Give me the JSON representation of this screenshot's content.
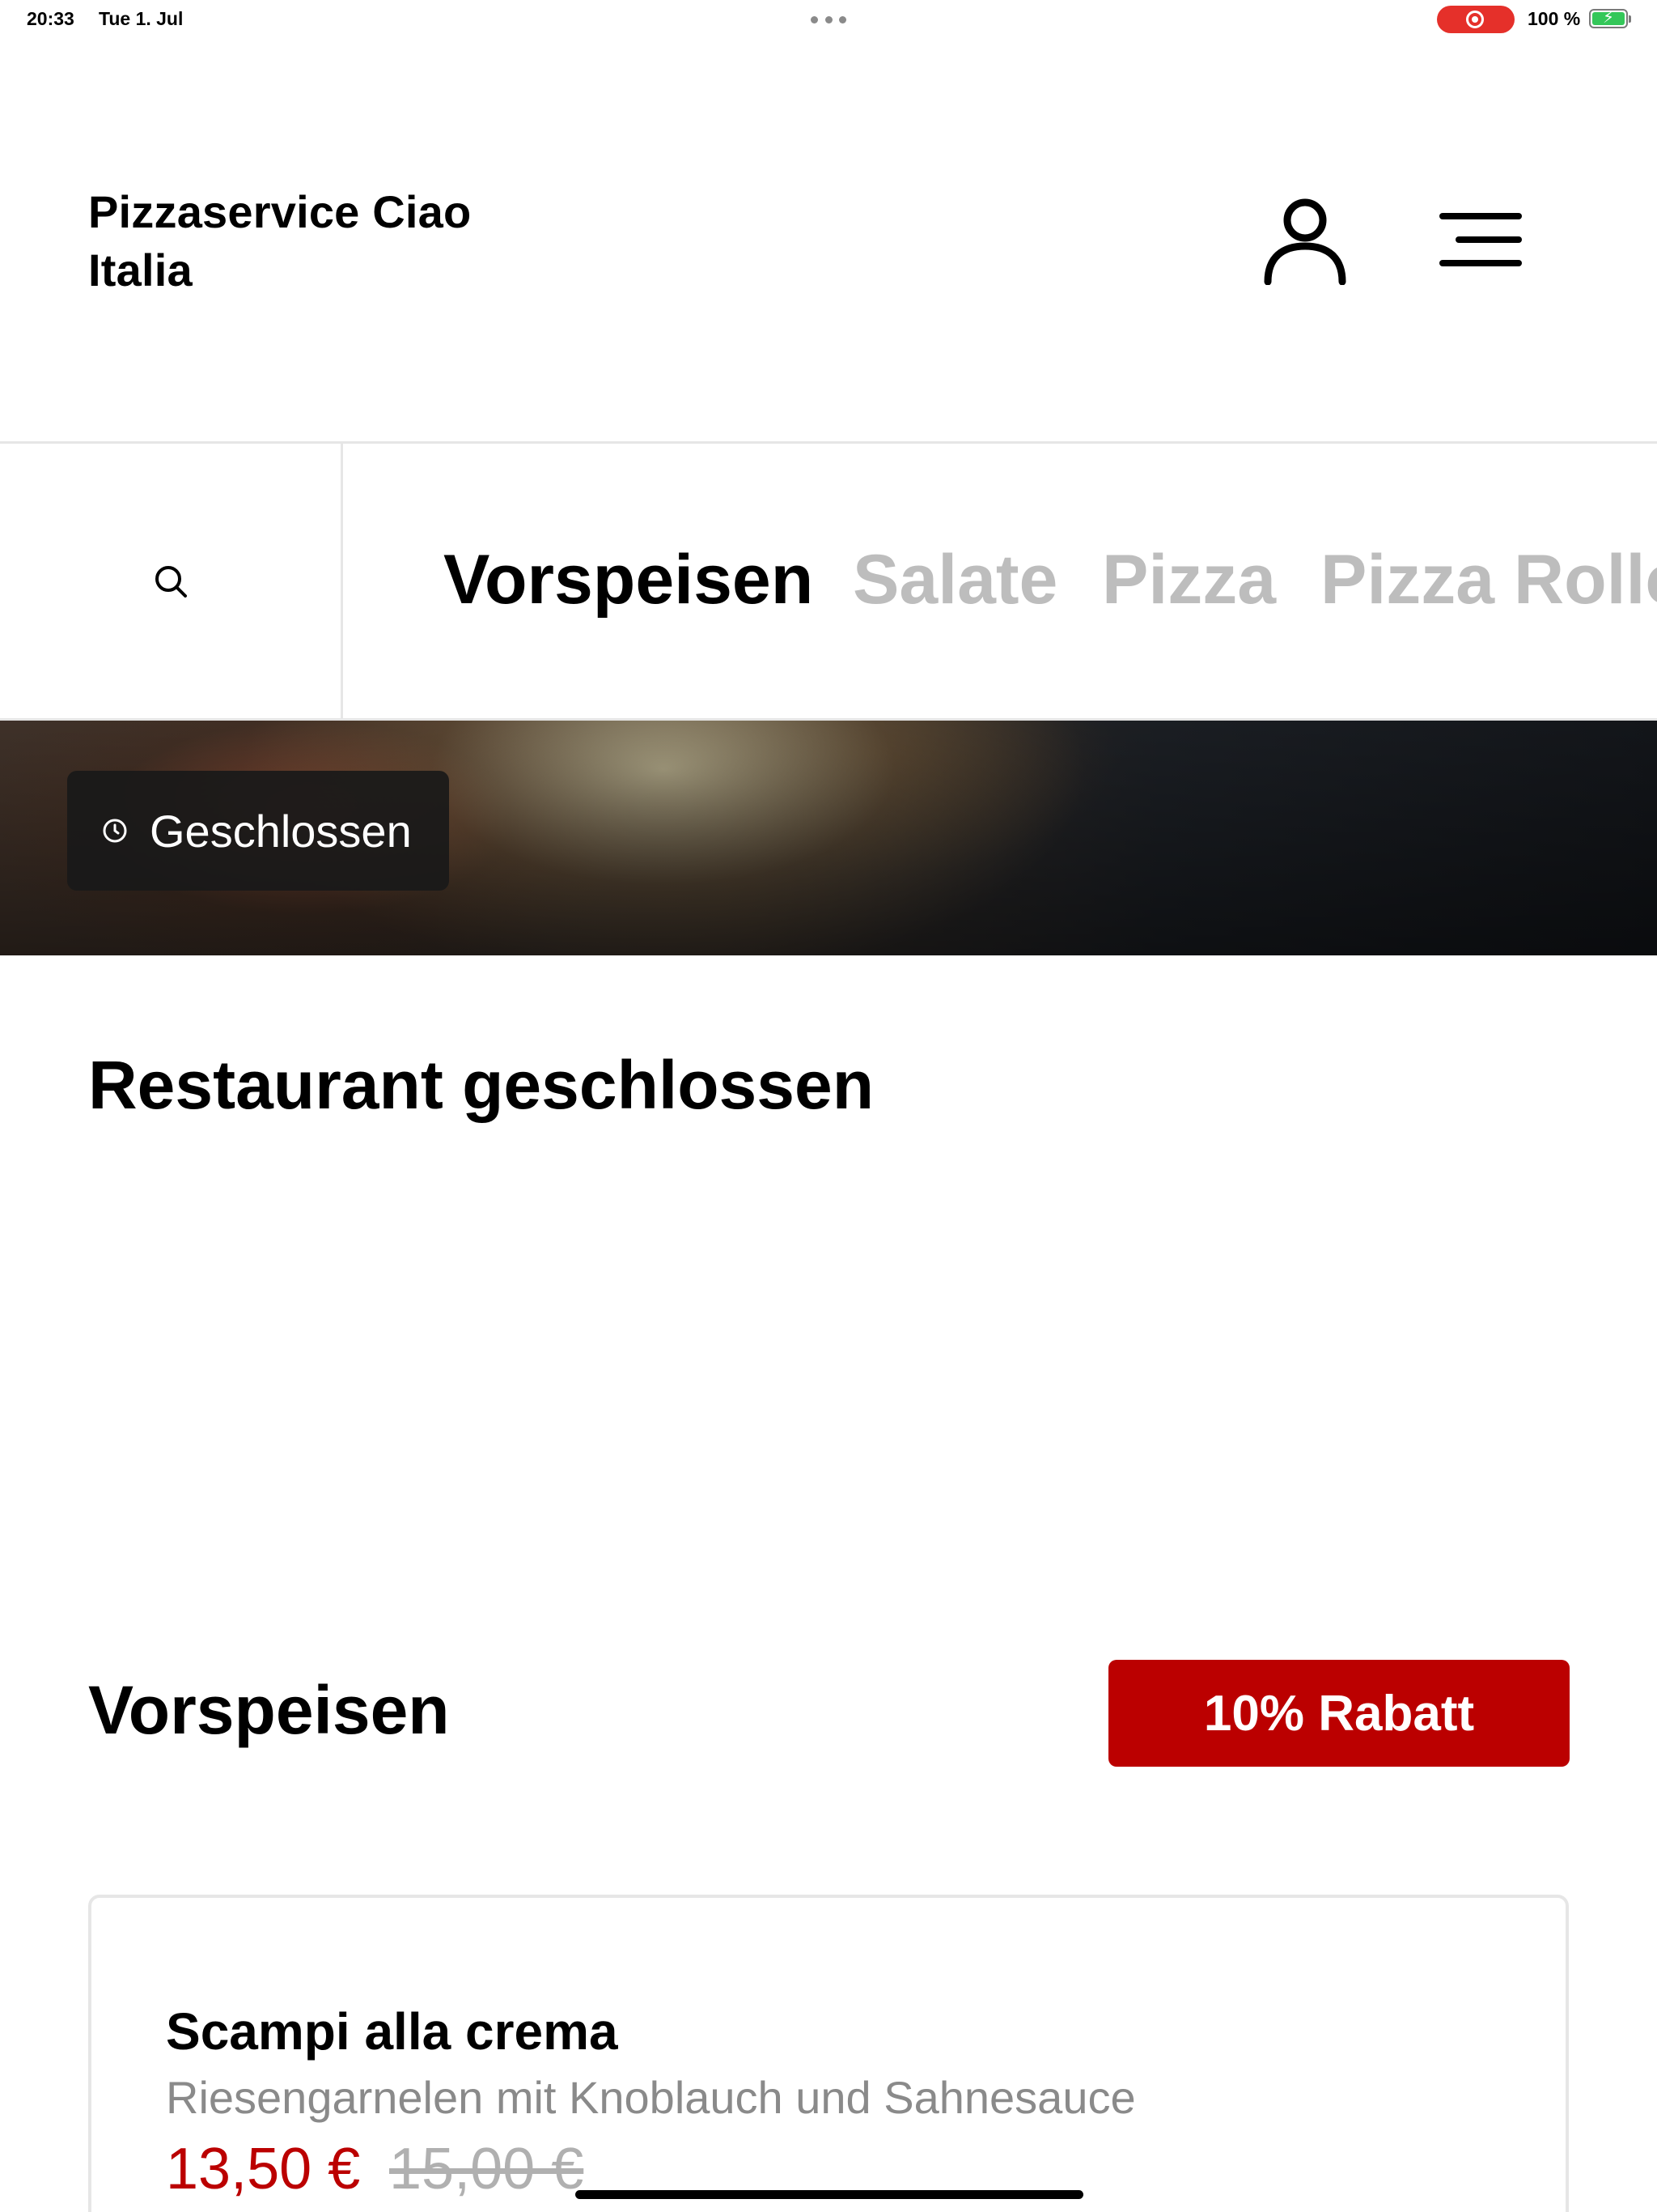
{
  "status_bar": {
    "time": "20:33",
    "date": "Tue 1. Jul",
    "battery_percent": "100 %",
    "icons": [
      "screen-recording-icon",
      "battery-charging-icon"
    ]
  },
  "header": {
    "brand": "Pizzaservice Ciao Italia",
    "icons": [
      "user-icon",
      "hamburger-menu-icon"
    ]
  },
  "category_nav": {
    "search_icon": "search-icon",
    "tabs": [
      {
        "label": "Vorspeisen",
        "active": true
      },
      {
        "label": "Salate",
        "active": false
      },
      {
        "label": "Pizza",
        "active": false
      },
      {
        "label": "Pizza Rollo",
        "active": false
      }
    ]
  },
  "hero": {
    "status_label": "Geschlossen",
    "status_icon": "clock-icon"
  },
  "notice": {
    "title": "Restaurant geschlossen"
  },
  "section": {
    "title": "Vorspeisen",
    "discount_label": "10% Rabatt"
  },
  "items": [
    {
      "name": "Scampi alla crema",
      "description": "Riesengarnelen mit Knoblauch und Sahnesauce",
      "price": "13,50 €",
      "old_price": "15,00 €"
    }
  ],
  "colors": {
    "accent": "#bb0000",
    "inactive_tab": "#bdbdbd",
    "divider": "#e6e6e6",
    "recording": "#e5302a",
    "battery": "#34c759"
  }
}
